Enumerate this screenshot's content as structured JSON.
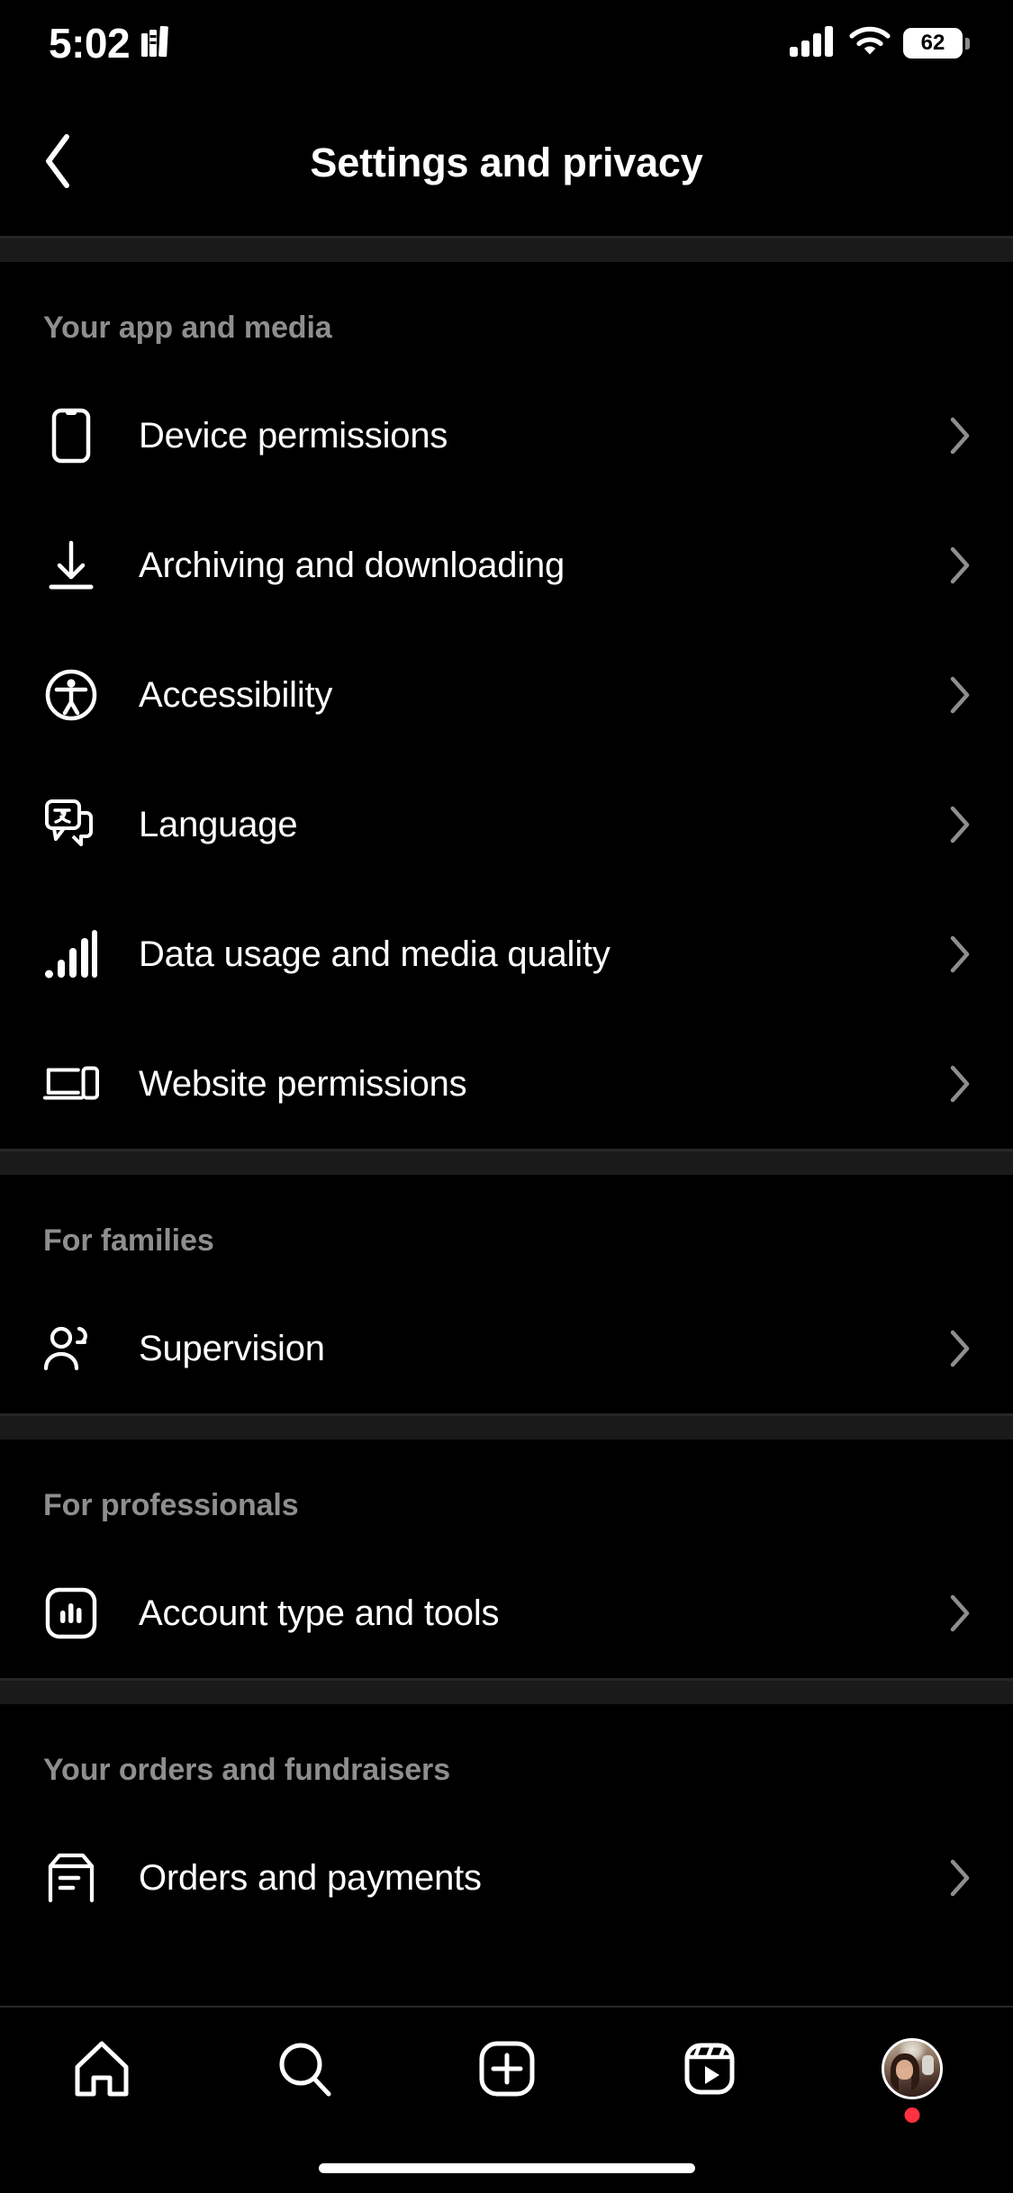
{
  "status_bar": {
    "time": "5:02",
    "app_icon": "books-icon",
    "signal_icon": "cellular-signal-icon",
    "wifi_icon": "wifi-icon",
    "battery_level": "62"
  },
  "header": {
    "back_icon": "chevron-left-icon",
    "title": "Settings and privacy"
  },
  "sections": [
    {
      "title": "Your app and media",
      "items": [
        {
          "label": "Device permissions",
          "icon": "phone-icon",
          "chevron": "chevron-right-icon"
        },
        {
          "label": "Archiving and downloading",
          "icon": "download-icon",
          "chevron": "chevron-right-icon"
        },
        {
          "label": "Accessibility",
          "icon": "accessibility-icon",
          "chevron": "chevron-right-icon"
        },
        {
          "label": "Language",
          "icon": "translate-icon",
          "chevron": "chevron-right-icon"
        },
        {
          "label": "Data usage and media quality",
          "icon": "signal-bars-icon",
          "chevron": "chevron-right-icon"
        },
        {
          "label": "Website permissions",
          "icon": "devices-icon",
          "chevron": "chevron-right-icon"
        }
      ]
    },
    {
      "title": "For families",
      "items": [
        {
          "label": "Supervision",
          "icon": "people-icon",
          "chevron": "chevron-right-icon"
        }
      ]
    },
    {
      "title": "For professionals",
      "items": [
        {
          "label": "Account type and tools",
          "icon": "bar-chart-square-icon",
          "chevron": "chevron-right-icon"
        }
      ]
    },
    {
      "title": "Your orders and fundraisers",
      "items": [
        {
          "label": "Orders and payments",
          "icon": "package-icon",
          "chevron": "chevron-right-icon"
        }
      ]
    }
  ],
  "tab_bar": {
    "tabs": [
      {
        "name": "home",
        "icon": "home-icon"
      },
      {
        "name": "search",
        "icon": "search-icon"
      },
      {
        "name": "create",
        "icon": "plus-square-icon"
      },
      {
        "name": "reels",
        "icon": "reels-icon"
      },
      {
        "name": "profile",
        "icon": "avatar-icon"
      }
    ],
    "notification_dot_color": "#ff3040"
  },
  "colors": {
    "background": "#000000",
    "text_primary": "#ffffff",
    "text_secondary": "#8e8e8e",
    "divider": "#262626",
    "section_band": "#1a1a1a",
    "chevron": "#8e8e8e"
  }
}
